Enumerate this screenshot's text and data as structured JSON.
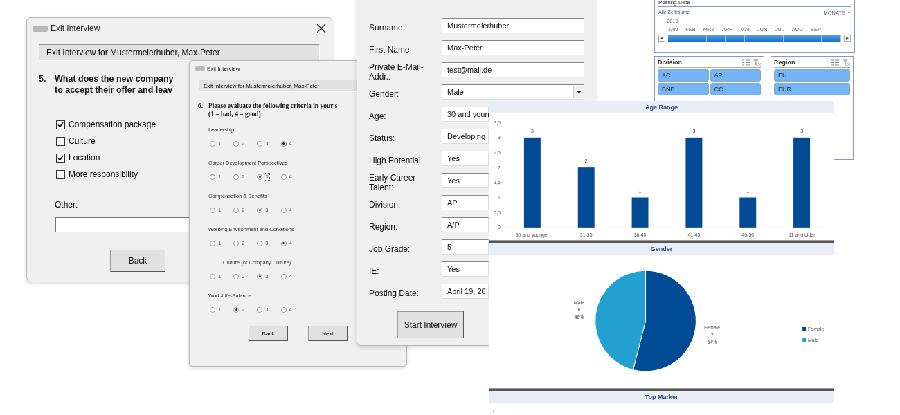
{
  "question_dialog": {
    "title": "Exit Interview",
    "header": "Exit Interview for Mustermeierhuber, Max-Peter",
    "number": "5.",
    "question_lines": [
      "What does the new company",
      "to accept their offer and leav"
    ],
    "options": [
      {
        "label": "Compensation package",
        "checked": true
      },
      {
        "label": "Culture",
        "checked": false
      },
      {
        "label": "Location",
        "checked": true
      },
      {
        "label": "More responsibility",
        "checked": false
      }
    ],
    "other_label": "Other:",
    "back_button": "Back"
  },
  "rating_dialog": {
    "title": "Exit Interview",
    "header": "Exit Interview for Mustermeierhuber, Max-Peter",
    "number": "6.",
    "question_lines": [
      "Please evaluate the following criteria in your s",
      "(1 = bad, 4 = good):"
    ],
    "criteria": [
      {
        "label": "Leadership",
        "indented": false,
        "options": [
          {
            "label": "1",
            "selected": false,
            "focused": false
          },
          {
            "label": "2",
            "selected": false,
            "focused": false
          },
          {
            "label": "3",
            "selected": false,
            "focused": false
          },
          {
            "label": "4",
            "selected": true,
            "focused": false
          }
        ]
      },
      {
        "label": "Career Development Perspectives",
        "indented": false,
        "options": [
          {
            "label": "1",
            "selected": false,
            "focused": false
          },
          {
            "label": "2",
            "selected": false,
            "focused": false
          },
          {
            "label": "3",
            "selected": true,
            "focused": true
          },
          {
            "label": "4",
            "selected": false,
            "focused": false
          }
        ]
      },
      {
        "label": "Compensation & Benefits",
        "indented": false,
        "options": [
          {
            "label": "1",
            "selected": false,
            "focused": false
          },
          {
            "label": "2",
            "selected": false,
            "focused": false
          },
          {
            "label": "3",
            "selected": true,
            "focused": false
          },
          {
            "label": "4",
            "selected": false,
            "focused": false
          }
        ]
      },
      {
        "label": "Working Environment and Conditions",
        "indented": false,
        "options": [
          {
            "label": "1",
            "selected": false,
            "focused": false
          },
          {
            "label": "2",
            "selected": false,
            "focused": false
          },
          {
            "label": "3",
            "selected": false,
            "focused": false
          },
          {
            "label": "4",
            "selected": true,
            "focused": false
          }
        ]
      },
      {
        "label": "Culture (or Company Culture)",
        "indented": true,
        "options": [
          {
            "label": "1",
            "selected": false,
            "focused": false
          },
          {
            "label": "2",
            "selected": false,
            "focused": false
          },
          {
            "label": "3",
            "selected": true,
            "focused": false
          },
          {
            "label": "4",
            "selected": false,
            "focused": false
          }
        ]
      },
      {
        "label": "Work-Life-Balance",
        "indented": false,
        "options": [
          {
            "label": "1",
            "selected": false,
            "focused": false
          },
          {
            "label": "2",
            "selected": true,
            "focused": false
          },
          {
            "label": "3",
            "selected": false,
            "focused": false
          },
          {
            "label": "4",
            "selected": false,
            "focused": false
          }
        ]
      }
    ],
    "buttons": [
      "Back",
      "Next"
    ]
  },
  "employee_form": {
    "fields": [
      {
        "label": "Surname:",
        "value": "Mustermeierhuber",
        "kind": "text"
      },
      {
        "label": "First Name:",
        "value": "Max-Peter",
        "kind": "text"
      },
      {
        "label": "Private E-Mail-Addr.:",
        "value": "test@mail.de",
        "kind": "text"
      },
      {
        "label": "Gender:",
        "value": "Male",
        "kind": "dropdown"
      },
      {
        "label": "Age:",
        "value": "30 and youn",
        "kind": "text"
      },
      {
        "label": "Status:",
        "value": "Developing",
        "kind": "text"
      },
      {
        "label": "High Potential:",
        "value": "Yes",
        "kind": "text"
      },
      {
        "label": "Early Career Talent:",
        "value": "Yes",
        "kind": "text"
      },
      {
        "label": "Division:",
        "value": "AP",
        "kind": "text"
      },
      {
        "label": "Region:",
        "value": "A/P",
        "kind": "text"
      },
      {
        "label": "Job Grade:",
        "value": "5",
        "kind": "text"
      },
      {
        "label": "IE:",
        "value": "Yes",
        "kind": "text"
      },
      {
        "label": "Posting Date:",
        "value": "April 19, 20",
        "kind": "text"
      }
    ],
    "start_button": "Start Interview"
  },
  "timeline": {
    "title": "Posting Date",
    "range_label": "Alle Zeiträume",
    "unit": "MONATE",
    "year": "2019",
    "months": [
      "JAN",
      "FEB",
      "MRZ",
      "APR",
      "MAI",
      "JUN",
      "JUL",
      "AUG",
      "SEP"
    ]
  },
  "slicers": [
    {
      "title": "Division",
      "items": [
        "AC",
        "AP",
        "BNB",
        "CC"
      ]
    },
    {
      "title": "Region",
      "items": [
        "EU",
        "EUR"
      ]
    }
  ],
  "age_range": {
    "title": "Age Range",
    "chart_data": {
      "type": "bar",
      "categories": [
        "30 and younger",
        "31-35",
        "36-40",
        "41-45",
        "46-50",
        "51 and older"
      ],
      "values": [
        3,
        2,
        1,
        3,
        1,
        3
      ],
      "ylim": [
        0,
        3.5
      ],
      "yticks": [
        {
          "value": 0,
          "label": "0"
        },
        {
          "value": 0.5,
          "label": "0,5"
        },
        {
          "value": 1,
          "label": "1"
        },
        {
          "value": 1.5,
          "label": "1,5"
        },
        {
          "value": 2,
          "label": "2"
        },
        {
          "value": 2.5,
          "label": "2,5"
        },
        {
          "value": 3,
          "label": "3"
        },
        {
          "value": 3.5,
          "label": "3,5"
        }
      ],
      "data_labels": true
    }
  },
  "gender": {
    "title": "Gender",
    "chart_data": {
      "type": "pie",
      "values": [
        54,
        46
      ],
      "value_labels": [
        [
          "Female",
          "7",
          "54%"
        ],
        [
          "Male",
          "6",
          "46%"
        ]
      ]
    },
    "legend": [
      {
        "label": "Female",
        "color": "#014a94"
      },
      {
        "label": "Male",
        "color": "#22a0d0"
      }
    ]
  },
  "top_marker": {
    "title": "Top Marker",
    "tick": "7"
  }
}
